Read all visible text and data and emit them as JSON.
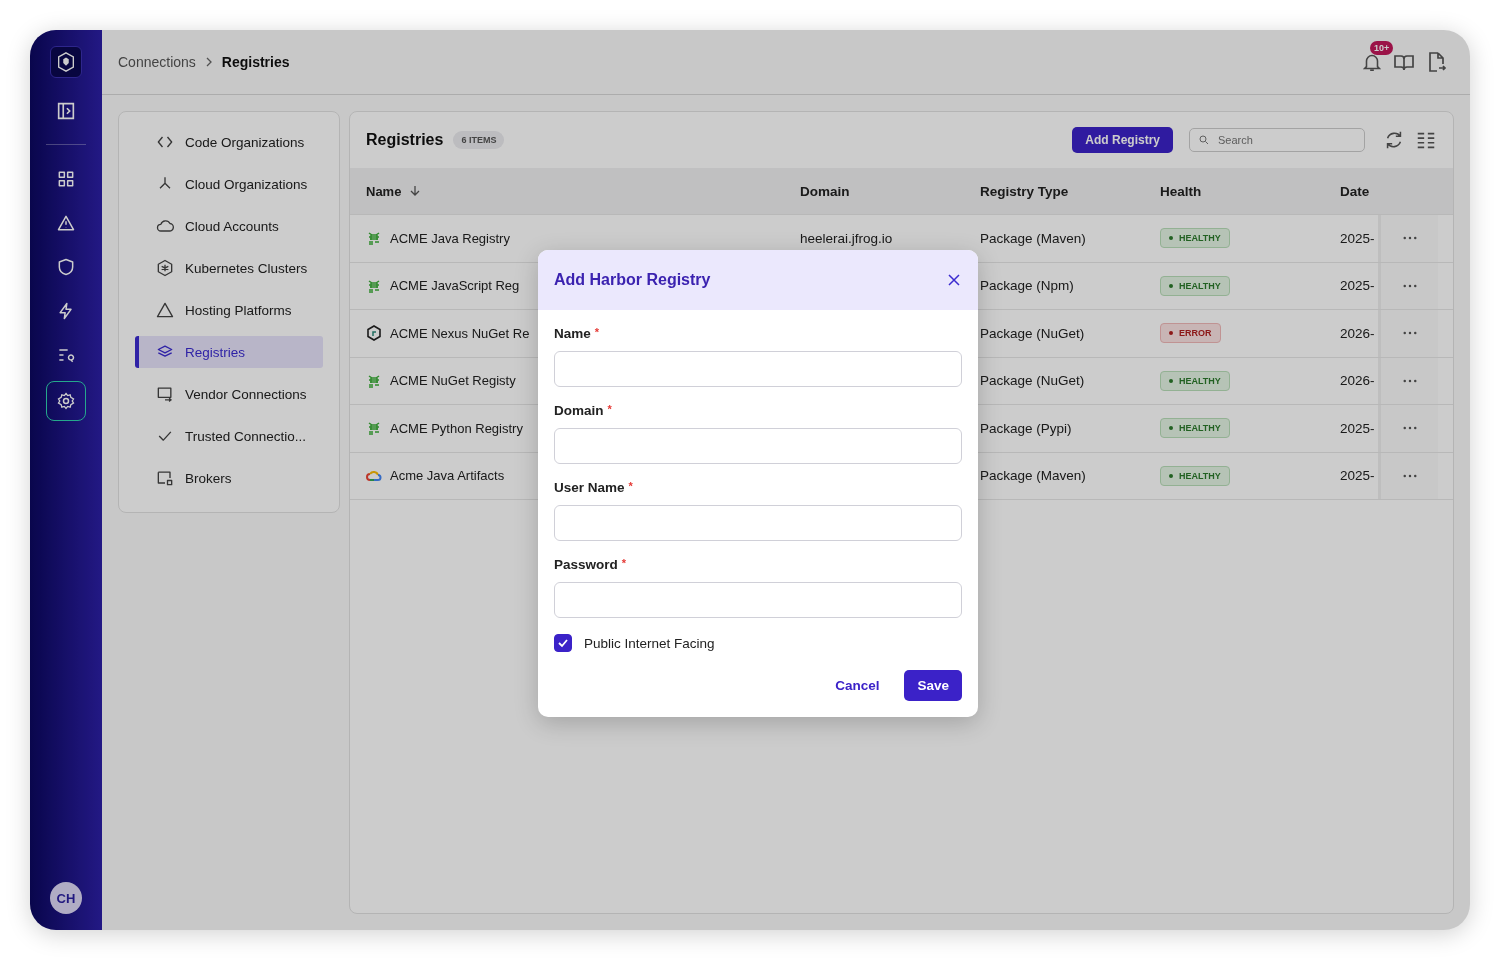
{
  "breadcrumb": [
    {
      "label": "Connections"
    },
    {
      "label": "Registries"
    }
  ],
  "notifications": {
    "badge": "10+"
  },
  "user": {
    "initials": "CH"
  },
  "nav": [
    {
      "label": "Code Organizations",
      "selected": false
    },
    {
      "label": "Cloud Organizations",
      "selected": false
    },
    {
      "label": "Cloud Accounts",
      "selected": false
    },
    {
      "label": "Kubernetes Clusters",
      "selected": false
    },
    {
      "label": "Hosting Platforms",
      "selected": false
    },
    {
      "label": "Registries",
      "selected": true
    },
    {
      "label": "Vendor Connections",
      "selected": false
    },
    {
      "label": "Trusted Connectio...",
      "selected": false
    },
    {
      "label": "Brokers",
      "selected": false
    }
  ],
  "panel": {
    "title": "Registries",
    "count": "6 ITEMS",
    "add_button": "Add Registry",
    "search": {
      "placeholder": "Search"
    }
  },
  "table": {
    "columns": [
      "Name",
      "Domain",
      "Registry Type",
      "Health",
      "Date"
    ],
    "rows": [
      {
        "kind": "jfrog",
        "name": "ACME Java Registry",
        "domain": "heelerai.jfrog.io",
        "type": "Package (Maven)",
        "health": "HEALTHY",
        "error": false,
        "date": "2025-"
      },
      {
        "kind": "jfrog",
        "name": "ACME JavaScript Reg",
        "domain": "",
        "type": "Package (Npm)",
        "health": "HEALTHY",
        "error": false,
        "date": "2025-"
      },
      {
        "kind": "nexus",
        "name": "ACME Nexus NuGet Re",
        "domain": "",
        "type": "Package (NuGet)",
        "health": "ERROR",
        "error": true,
        "date": "2026-"
      },
      {
        "kind": "jfrog",
        "name": "ACME NuGet Registy",
        "domain": "",
        "type": "Package (NuGet)",
        "health": "HEALTHY",
        "error": false,
        "date": "2026-"
      },
      {
        "kind": "jfrog",
        "name": "ACME Python Registry",
        "domain": "",
        "type": "Package (Pypi)",
        "health": "HEALTHY",
        "error": false,
        "date": "2025-"
      },
      {
        "kind": "gcloud",
        "name": "Acme Java Artifacts",
        "domain": "",
        "type": "Package (Maven)",
        "health": "HEALTHY",
        "error": false,
        "date": "2025-"
      }
    ]
  },
  "dialog": {
    "title": "Add Harbor Registry",
    "fields": [
      {
        "label": "Name",
        "required": "*"
      },
      {
        "label": "Domain",
        "required": "*"
      },
      {
        "label": "User Name",
        "required": "*"
      },
      {
        "label": "Password",
        "required": "*"
      }
    ],
    "checkbox": {
      "label": "Public Internet Facing",
      "checked": true
    },
    "buttons": {
      "cancel": "Cancel",
      "save": "Save"
    }
  }
}
